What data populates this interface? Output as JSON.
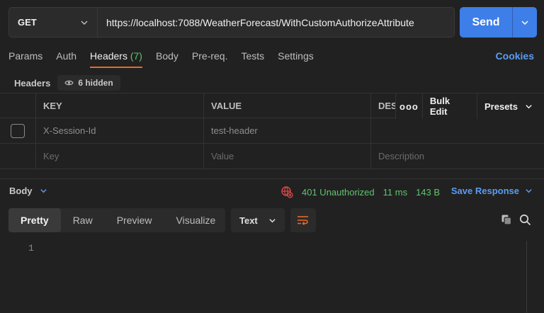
{
  "request": {
    "method": "GET",
    "url": "https://localhost:7088/WeatherForecast/WithCustomAuthorizeAttribute",
    "send_label": "Send"
  },
  "tabs": [
    {
      "label": "Params",
      "count": ""
    },
    {
      "label": "Auth",
      "count": ""
    },
    {
      "label": "Headers",
      "count": "(7)"
    },
    {
      "label": "Body",
      "count": ""
    },
    {
      "label": "Pre-req.",
      "count": ""
    },
    {
      "label": "Tests",
      "count": ""
    },
    {
      "label": "Settings",
      "count": ""
    }
  ],
  "active_tab": "Headers",
  "cookies_label": "Cookies",
  "headers_section": {
    "label": "Headers",
    "hidden_label": "6 hidden"
  },
  "table": {
    "columns": [
      "KEY",
      "VALUE",
      "DES"
    ],
    "actions": {
      "bulk_edit": "Bulk Edit",
      "presets": "Presets",
      "more": "ooo"
    },
    "rows": [
      {
        "key": "X-Session-Id",
        "value": "test-header",
        "description": ""
      }
    ],
    "placeholder": {
      "key": "Key",
      "value": "Value",
      "description": "Description"
    }
  },
  "response": {
    "body_label": "Body",
    "status": "401 Unauthorized",
    "time": "11 ms",
    "size": "143 B",
    "save_label": "Save Response",
    "view_tabs": [
      "Pretty",
      "Raw",
      "Preview",
      "Visualize"
    ],
    "active_view": "Pretty",
    "format": "Text",
    "line_numbers": [
      "1"
    ]
  },
  "colors": {
    "accent": "#3d7ee8",
    "active_tab_underline": "#e8692a",
    "success": "#5fc46f",
    "link": "#5a9cf2",
    "error_icon": "#e04848"
  }
}
